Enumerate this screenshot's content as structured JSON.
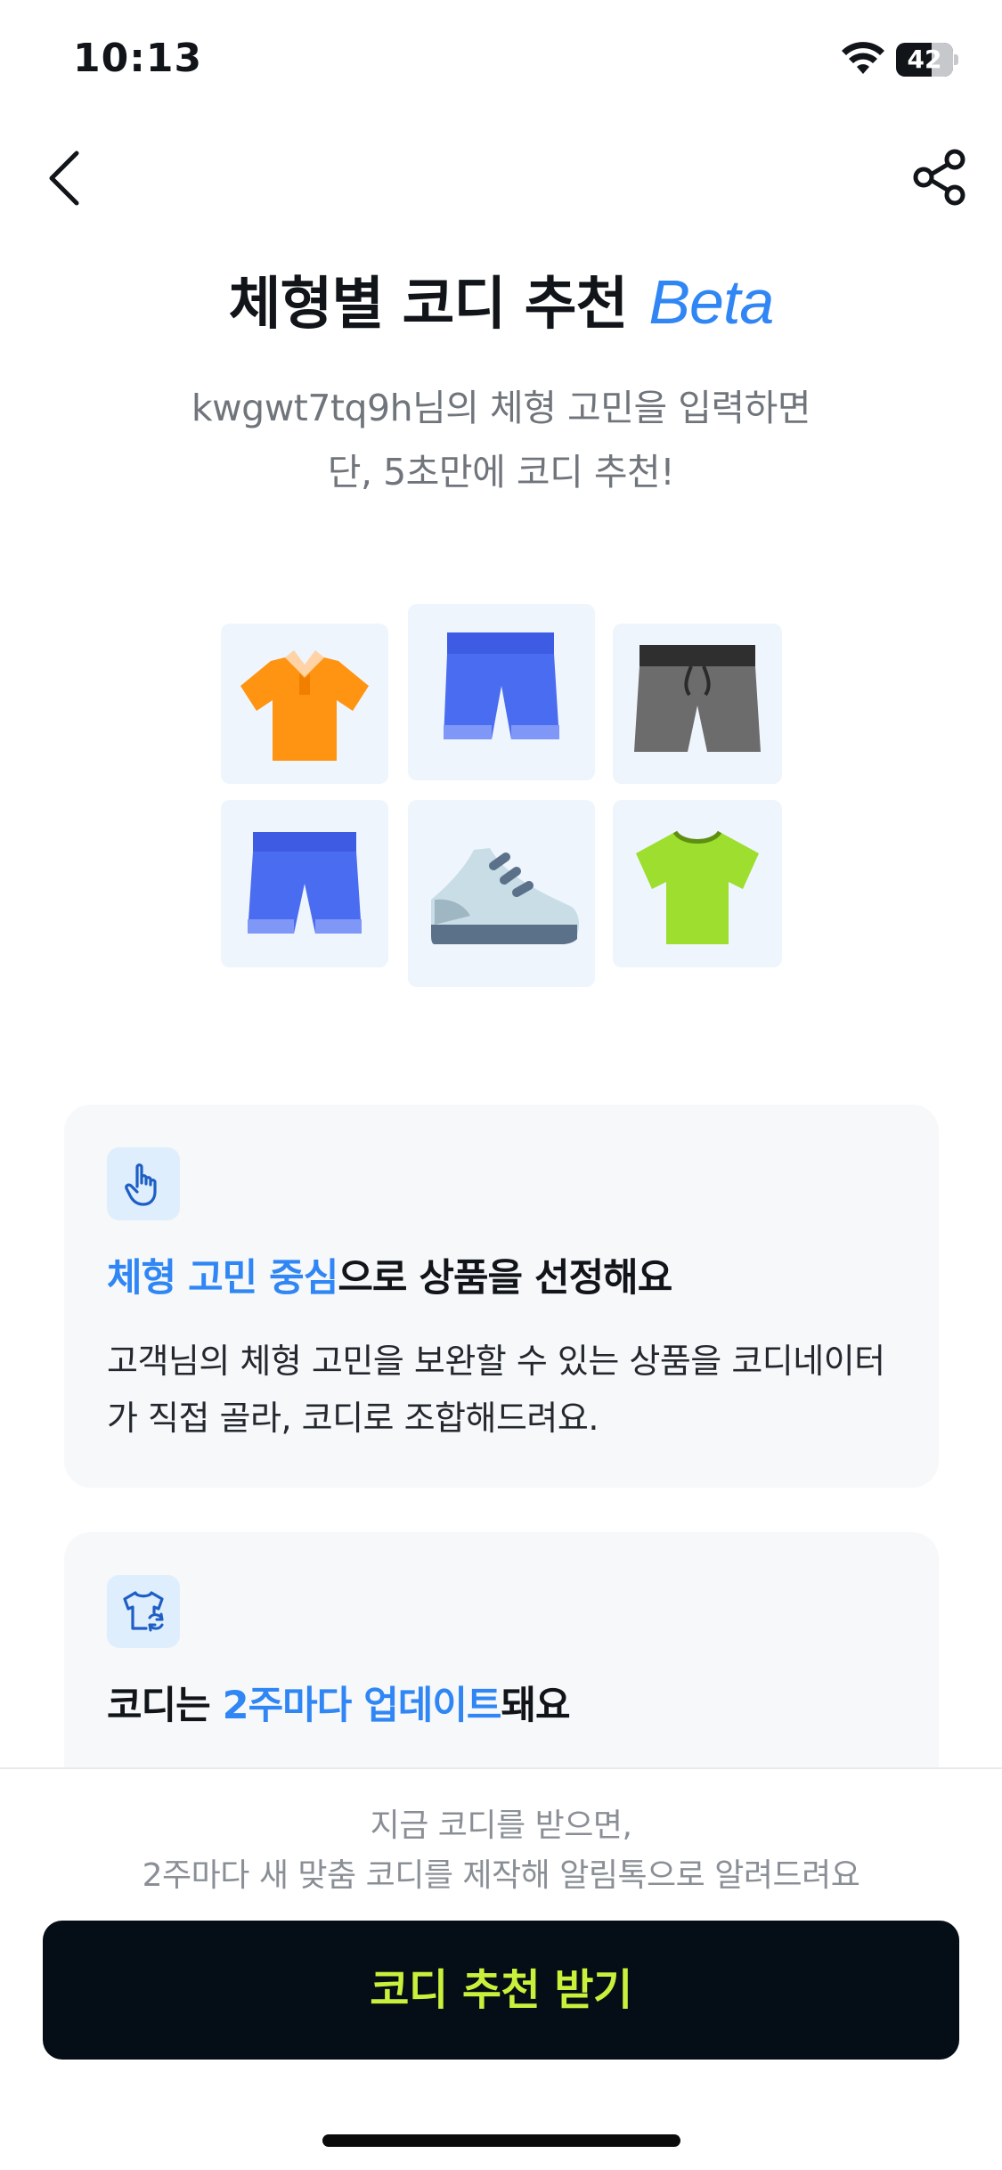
{
  "status_bar": {
    "time": "10:13",
    "battery": "42"
  },
  "header": {
    "back_icon": "chevron-left-icon",
    "share_icon": "share-icon"
  },
  "hero": {
    "title": "체형별 코디 추천",
    "badge": "Beta",
    "subtitle_line1": "kwgwt7tq9h님의 체형 고민을 입력하면",
    "subtitle_line2": "단, 5초만에 코디 추천!"
  },
  "illustration": {
    "items": [
      "orange-polo-shirt-icon",
      "blue-shorts-icon",
      "gray-shorts-icon",
      "blue-shorts-icon",
      "sneaker-icon",
      "green-tshirt-icon"
    ]
  },
  "features": [
    {
      "icon": "hand-pointer-icon",
      "heading_highlight": "체형 고민 중심",
      "heading_rest": "으로 상품을 선정해요",
      "body_line1": "고객님의 체형 고민을 보완할 수 있는 상품을 코디네이터",
      "body_line2": "가 직접 골라, 코디로 조합해드려요."
    },
    {
      "icon": "tshirt-refresh-icon",
      "heading_prefix": "코디는 ",
      "heading_highlight": "2주마다 업데이트",
      "heading_rest": "돼요"
    }
  ],
  "bottom": {
    "notice_line1": "지금 코디를 받으면,",
    "notice_line2": "2주마다 새 맞춤 코디를 제작해 알림톡으로 알려드려요",
    "cta_label": "코디 추천 받기"
  },
  "colors": {
    "accent": "#2f86f4",
    "cta_bg": "#050d16",
    "cta_text": "#c8f13c",
    "card_bg": "#f6f8fa"
  }
}
